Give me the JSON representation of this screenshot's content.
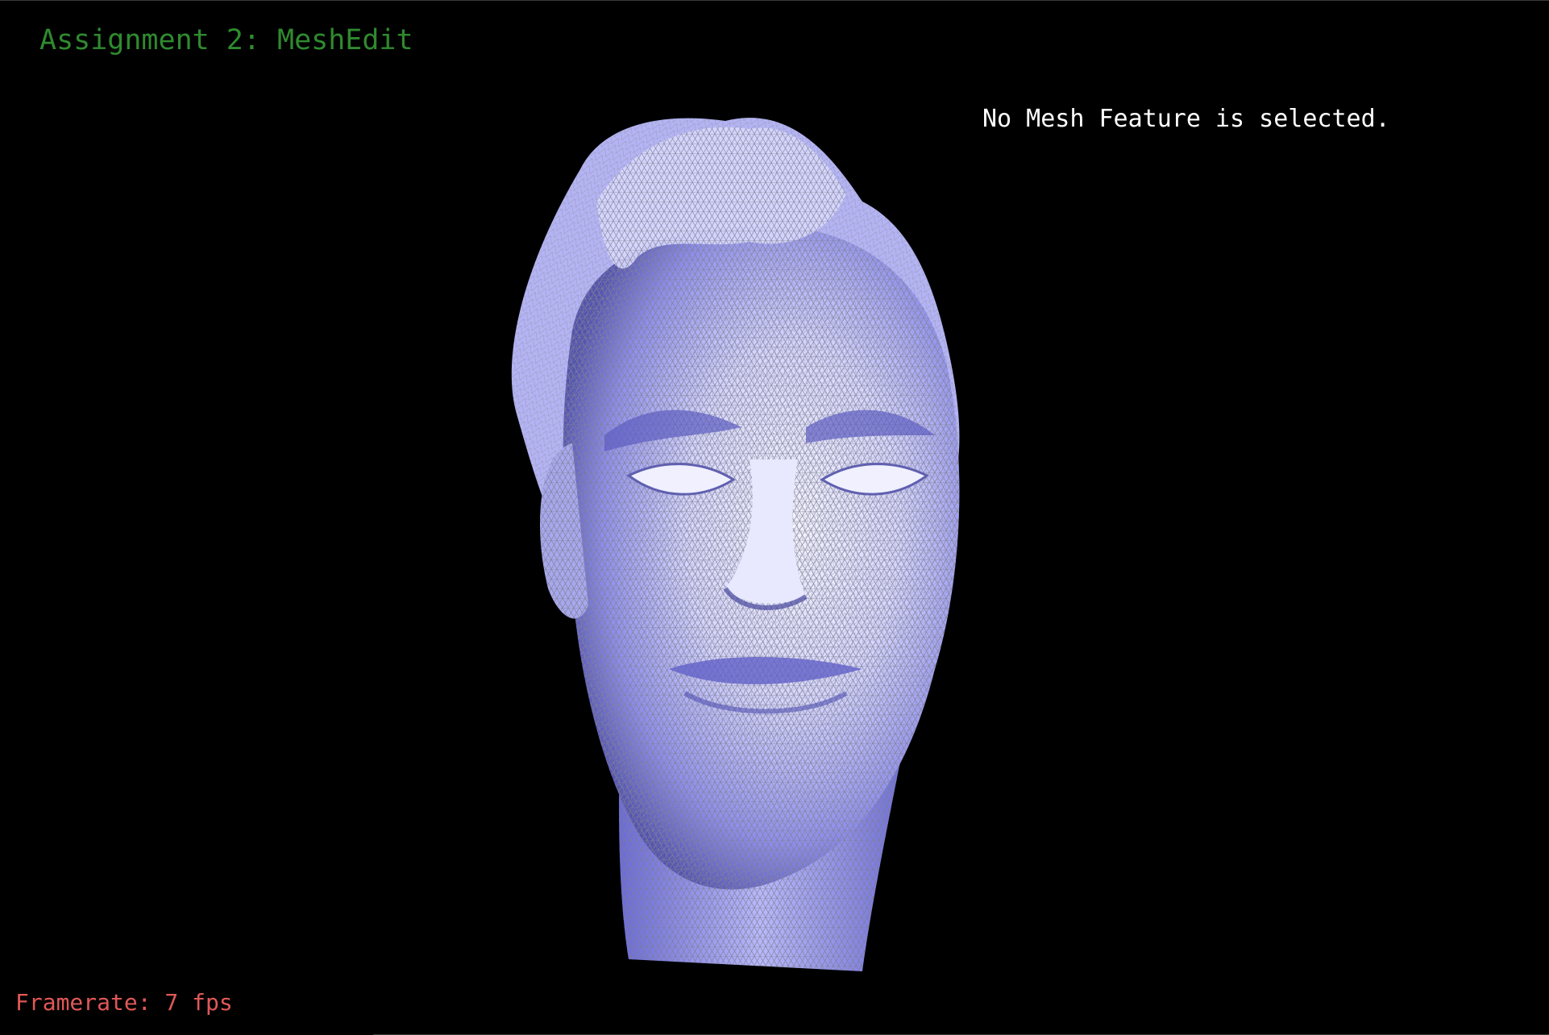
{
  "app": {
    "title": "Assignment 2: MeshEdit"
  },
  "status": {
    "selection_text": "No Mesh Feature is selected.",
    "framerate_text": "Framerate: 7 fps"
  },
  "colors": {
    "title": "#2f8a2f",
    "selection_text": "#ffffff",
    "framerate_text": "#e05858",
    "mesh_fill": "#c8c8ff",
    "mesh_wire": "#8c8c9c",
    "background": "#000000"
  },
  "viewport": {
    "model": "head-mesh"
  }
}
